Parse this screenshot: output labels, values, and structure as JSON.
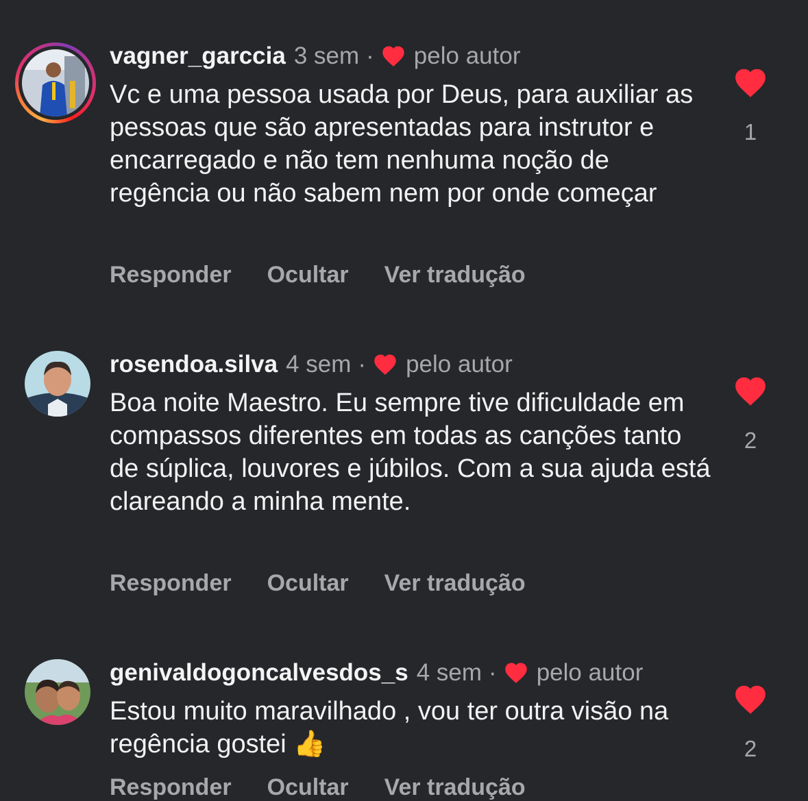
{
  "comments": [
    {
      "username": "vagner_garccia",
      "time": "3 sem",
      "dot": "·",
      "author_badge": "pelo autor",
      "text": "Vc e uma pessoa usada por Deus, para auxiliar as pessoas que são apresentadas para instrutor e encarregado e não tem nenhuma noção de regência ou não sabem nem por onde começar",
      "likes": "1",
      "has_story_ring": true
    },
    {
      "username": "rosendoa.silva",
      "time": "4 sem",
      "dot": "·",
      "author_badge": "pelo autor",
      "text": "Boa noite Maestro.  Eu sempre tive dificuldade em compassos diferentes em todas as canções tanto de súplica, louvores e júbilos. Com a sua ajuda está clareando a minha mente.",
      "likes": "2",
      "has_story_ring": false
    },
    {
      "username": "genivaldogoncalvesdos_s",
      "time": "4 sem",
      "dot": "·",
      "author_badge": "pelo autor",
      "text": "Estou muito maravilhado , vou ter outra visão na regência gostei 👍",
      "likes": "2",
      "has_story_ring": false
    }
  ],
  "actions": {
    "reply": "Responder",
    "hide": "Ocultar",
    "translate": "Ver tradução"
  },
  "colors": {
    "background": "#25272b",
    "heart": "#ff2d3f",
    "muted_text": "#a7a8ab"
  },
  "icons": {
    "like": "heart-icon",
    "author_like": "heart-icon"
  }
}
